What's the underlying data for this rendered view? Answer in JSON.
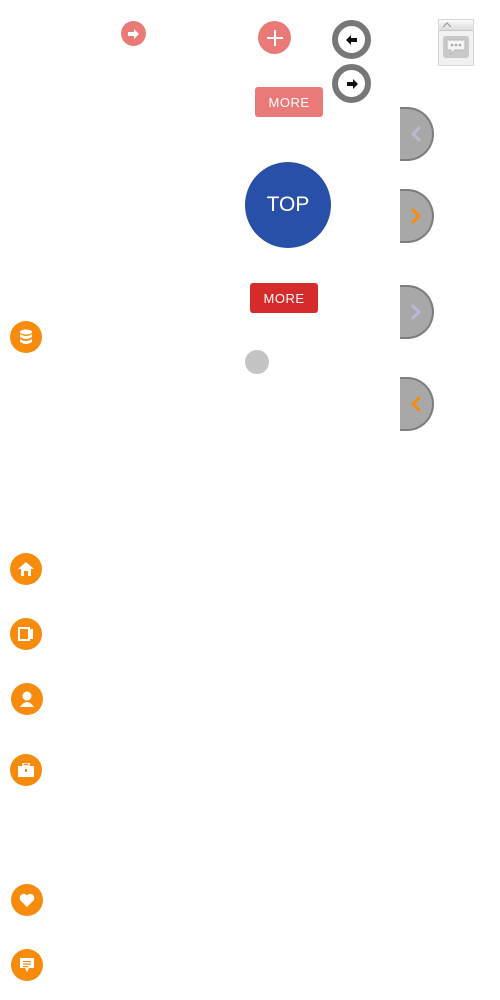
{
  "buttons": {
    "more_light_label": "MORE",
    "top_label": "TOP",
    "more_red_label": "MORE"
  },
  "icons": {
    "small_arrow": "arrow-right-icon",
    "plus": "plus-icon",
    "back": "arrow-left-icon",
    "forward": "arrow-right-icon",
    "chat": "chat-icon",
    "database": "database-icon",
    "home": "home-icon",
    "book": "book-icon",
    "user": "user-icon",
    "briefcase": "briefcase-icon",
    "heart": "heart-icon",
    "message": "message-icon"
  },
  "colors": {
    "salmon": "#e97a78",
    "navy": "#2850a8",
    "red": "#d62b2b",
    "orange": "#f78c0c",
    "gray": "#a8a8a8"
  }
}
